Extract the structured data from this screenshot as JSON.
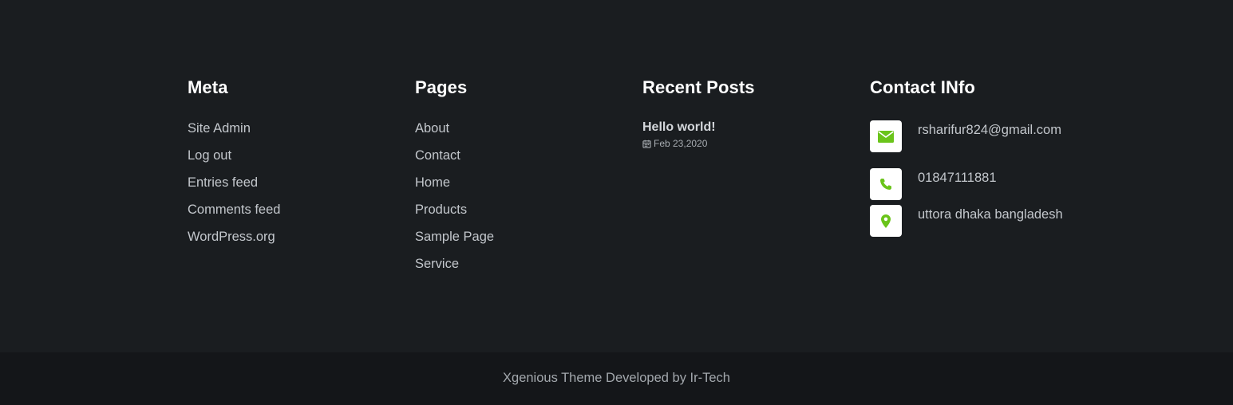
{
  "meta": {
    "title": "Meta",
    "links": [
      "Site Admin",
      "Log out",
      "Entries feed",
      "Comments feed",
      "WordPress.org"
    ]
  },
  "pages": {
    "title": "Pages",
    "links": [
      "About",
      "Contact",
      "Home",
      "Products",
      "Sample Page",
      "Service"
    ]
  },
  "recent_posts": {
    "title": "Recent Posts",
    "posts": [
      {
        "title": "Hello world!",
        "date": "Feb 23,2020",
        "icon": "calendar-icon"
      }
    ]
  },
  "contact": {
    "title": "Contact INfo",
    "items": [
      {
        "icon": "envelope-icon",
        "text": "rsharifur824@gmail.com"
      },
      {
        "icon": "phone-icon",
        "text": "01847111881"
      },
      {
        "icon": "map-marker-icon",
        "text": "uttora dhaka bangladesh"
      }
    ]
  },
  "footer": {
    "copyright": "Xgenious Theme Developed by Ir-Tech"
  },
  "colors": {
    "background": "#1a1d20",
    "bottom_bar": "#141619",
    "accent": "#6ac41a",
    "heading": "#ffffff"
  }
}
